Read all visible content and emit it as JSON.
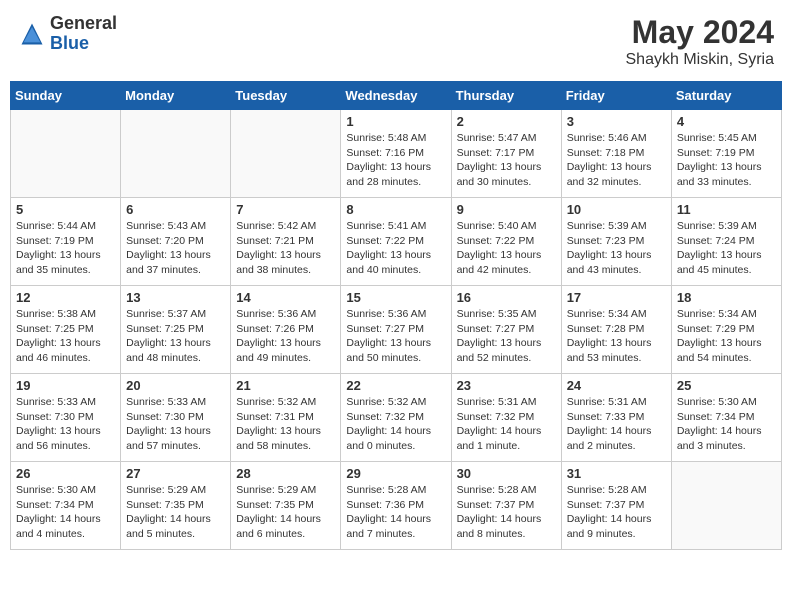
{
  "header": {
    "logo_general": "General",
    "logo_blue": "Blue",
    "month_year": "May 2024",
    "location": "Shaykh Miskin, Syria"
  },
  "days_of_week": [
    "Sunday",
    "Monday",
    "Tuesday",
    "Wednesday",
    "Thursday",
    "Friday",
    "Saturday"
  ],
  "weeks": [
    [
      {
        "day": "",
        "info": ""
      },
      {
        "day": "",
        "info": ""
      },
      {
        "day": "",
        "info": ""
      },
      {
        "day": "1",
        "info": "Sunrise: 5:48 AM\nSunset: 7:16 PM\nDaylight: 13 hours\nand 28 minutes."
      },
      {
        "day": "2",
        "info": "Sunrise: 5:47 AM\nSunset: 7:17 PM\nDaylight: 13 hours\nand 30 minutes."
      },
      {
        "day": "3",
        "info": "Sunrise: 5:46 AM\nSunset: 7:18 PM\nDaylight: 13 hours\nand 32 minutes."
      },
      {
        "day": "4",
        "info": "Sunrise: 5:45 AM\nSunset: 7:19 PM\nDaylight: 13 hours\nand 33 minutes."
      }
    ],
    [
      {
        "day": "5",
        "info": "Sunrise: 5:44 AM\nSunset: 7:19 PM\nDaylight: 13 hours\nand 35 minutes."
      },
      {
        "day": "6",
        "info": "Sunrise: 5:43 AM\nSunset: 7:20 PM\nDaylight: 13 hours\nand 37 minutes."
      },
      {
        "day": "7",
        "info": "Sunrise: 5:42 AM\nSunset: 7:21 PM\nDaylight: 13 hours\nand 38 minutes."
      },
      {
        "day": "8",
        "info": "Sunrise: 5:41 AM\nSunset: 7:22 PM\nDaylight: 13 hours\nand 40 minutes."
      },
      {
        "day": "9",
        "info": "Sunrise: 5:40 AM\nSunset: 7:22 PM\nDaylight: 13 hours\nand 42 minutes."
      },
      {
        "day": "10",
        "info": "Sunrise: 5:39 AM\nSunset: 7:23 PM\nDaylight: 13 hours\nand 43 minutes."
      },
      {
        "day": "11",
        "info": "Sunrise: 5:39 AM\nSunset: 7:24 PM\nDaylight: 13 hours\nand 45 minutes."
      }
    ],
    [
      {
        "day": "12",
        "info": "Sunrise: 5:38 AM\nSunset: 7:25 PM\nDaylight: 13 hours\nand 46 minutes."
      },
      {
        "day": "13",
        "info": "Sunrise: 5:37 AM\nSunset: 7:25 PM\nDaylight: 13 hours\nand 48 minutes."
      },
      {
        "day": "14",
        "info": "Sunrise: 5:36 AM\nSunset: 7:26 PM\nDaylight: 13 hours\nand 49 minutes."
      },
      {
        "day": "15",
        "info": "Sunrise: 5:36 AM\nSunset: 7:27 PM\nDaylight: 13 hours\nand 50 minutes."
      },
      {
        "day": "16",
        "info": "Sunrise: 5:35 AM\nSunset: 7:27 PM\nDaylight: 13 hours\nand 52 minutes."
      },
      {
        "day": "17",
        "info": "Sunrise: 5:34 AM\nSunset: 7:28 PM\nDaylight: 13 hours\nand 53 minutes."
      },
      {
        "day": "18",
        "info": "Sunrise: 5:34 AM\nSunset: 7:29 PM\nDaylight: 13 hours\nand 54 minutes."
      }
    ],
    [
      {
        "day": "19",
        "info": "Sunrise: 5:33 AM\nSunset: 7:30 PM\nDaylight: 13 hours\nand 56 minutes."
      },
      {
        "day": "20",
        "info": "Sunrise: 5:33 AM\nSunset: 7:30 PM\nDaylight: 13 hours\nand 57 minutes."
      },
      {
        "day": "21",
        "info": "Sunrise: 5:32 AM\nSunset: 7:31 PM\nDaylight: 13 hours\nand 58 minutes."
      },
      {
        "day": "22",
        "info": "Sunrise: 5:32 AM\nSunset: 7:32 PM\nDaylight: 14 hours\nand 0 minutes."
      },
      {
        "day": "23",
        "info": "Sunrise: 5:31 AM\nSunset: 7:32 PM\nDaylight: 14 hours\nand 1 minute."
      },
      {
        "day": "24",
        "info": "Sunrise: 5:31 AM\nSunset: 7:33 PM\nDaylight: 14 hours\nand 2 minutes."
      },
      {
        "day": "25",
        "info": "Sunrise: 5:30 AM\nSunset: 7:34 PM\nDaylight: 14 hours\nand 3 minutes."
      }
    ],
    [
      {
        "day": "26",
        "info": "Sunrise: 5:30 AM\nSunset: 7:34 PM\nDaylight: 14 hours\nand 4 minutes."
      },
      {
        "day": "27",
        "info": "Sunrise: 5:29 AM\nSunset: 7:35 PM\nDaylight: 14 hours\nand 5 minutes."
      },
      {
        "day": "28",
        "info": "Sunrise: 5:29 AM\nSunset: 7:35 PM\nDaylight: 14 hours\nand 6 minutes."
      },
      {
        "day": "29",
        "info": "Sunrise: 5:28 AM\nSunset: 7:36 PM\nDaylight: 14 hours\nand 7 minutes."
      },
      {
        "day": "30",
        "info": "Sunrise: 5:28 AM\nSunset: 7:37 PM\nDaylight: 14 hours\nand 8 minutes."
      },
      {
        "day": "31",
        "info": "Sunrise: 5:28 AM\nSunset: 7:37 PM\nDaylight: 14 hours\nand 9 minutes."
      },
      {
        "day": "",
        "info": ""
      }
    ]
  ]
}
